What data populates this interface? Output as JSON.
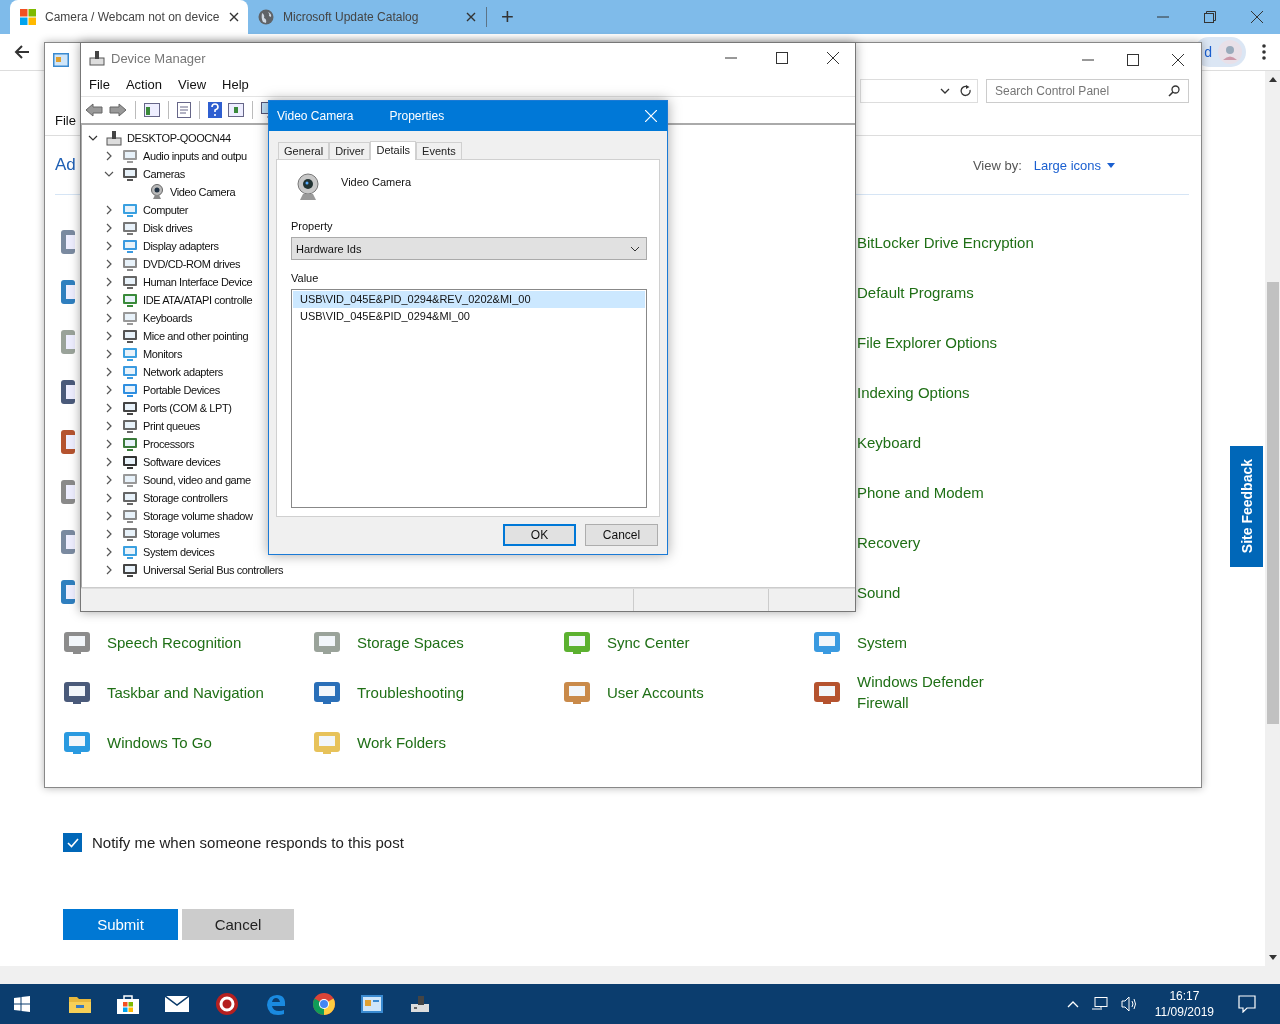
{
  "browser": {
    "tabs": [
      {
        "title": "Camera / Webcam not on device",
        "selected": true
      },
      {
        "title": "Microsoft Update Catalog",
        "selected": false
      }
    ],
    "new_tab": "+",
    "extension_label": "d"
  },
  "control_panel": {
    "menu_item": "File",
    "heading": "Ad",
    "search": {
      "placeholder": "Search Control Panel"
    },
    "view_by": {
      "label": "View by:",
      "value": "Large icons"
    },
    "items": [
      {
        "label": "BitLocker Drive Encryption"
      },
      {
        "label": "Default Programs"
      },
      {
        "label": "File Explorer Options"
      },
      {
        "label": "Indexing Options"
      },
      {
        "label": "Keyboard"
      },
      {
        "label": "Phone and Modem"
      },
      {
        "label": "Recovery"
      },
      {
        "label": "Sound"
      },
      {
        "label": "Speech Recognition"
      },
      {
        "label": "Storage Spaces"
      },
      {
        "label": "Sync Center"
      },
      {
        "label": "System"
      },
      {
        "label": "Taskbar and Navigation"
      },
      {
        "label": "Troubleshooting"
      },
      {
        "label": "User Accounts"
      },
      {
        "label": "Windows Defender Firewall"
      },
      {
        "label": "Windows To Go"
      },
      {
        "label": "Work Folders"
      }
    ]
  },
  "device_manager": {
    "title": "Device Manager",
    "menu": [
      "File",
      "Action",
      "View",
      "Help"
    ],
    "tree": {
      "label": "DESKTOP-QOOCN44",
      "expanded": true,
      "children": [
        {
          "label": "Audio inputs and outpu",
          "expanded": false
        },
        {
          "label": "Cameras",
          "expanded": true,
          "children": [
            {
              "label": "Video Camera"
            }
          ]
        },
        {
          "label": "Computer",
          "expanded": false
        },
        {
          "label": "Disk drives",
          "expanded": false
        },
        {
          "label": "Display adapters",
          "expanded": false
        },
        {
          "label": "DVD/CD-ROM drives",
          "expanded": false
        },
        {
          "label": "Human Interface Device",
          "expanded": false
        },
        {
          "label": "IDE ATA/ATAPI controlle",
          "expanded": false
        },
        {
          "label": "Keyboards",
          "expanded": false
        },
        {
          "label": "Mice and other pointing",
          "expanded": false
        },
        {
          "label": "Monitors",
          "expanded": false
        },
        {
          "label": "Network adapters",
          "expanded": false
        },
        {
          "label": "Portable Devices",
          "expanded": false
        },
        {
          "label": "Ports (COM & LPT)",
          "expanded": false
        },
        {
          "label": "Print queues",
          "expanded": false
        },
        {
          "label": "Processors",
          "expanded": false
        },
        {
          "label": "Software devices",
          "expanded": false
        },
        {
          "label": "Sound, video and game",
          "expanded": false
        },
        {
          "label": "Storage controllers",
          "expanded": false
        },
        {
          "label": "Storage volume shadow",
          "expanded": false
        },
        {
          "label": "Storage volumes",
          "expanded": false
        },
        {
          "label": "System devices",
          "expanded": false
        },
        {
          "label": "Universal Serial Bus controllers",
          "expanded": false
        }
      ]
    }
  },
  "properties_dialog": {
    "title": [
      "Video Camera",
      "Properties"
    ],
    "tabs": [
      {
        "label": "General",
        "selected": false
      },
      {
        "label": "Driver",
        "selected": false
      },
      {
        "label": "Details",
        "selected": true
      },
      {
        "label": "Events",
        "selected": false
      }
    ],
    "device_name": "Video Camera",
    "property_label": "Property",
    "property_value": "Hardware Ids",
    "value_label": "Value",
    "values": [
      {
        "text": "USB\\VID_045E&PID_0294&REV_0202&MI_00",
        "selected": true
      },
      {
        "text": "USB\\VID_045E&PID_0294&MI_00",
        "selected": false
      }
    ],
    "buttons": [
      {
        "label": "OK",
        "default": true
      },
      {
        "label": "Cancel",
        "default": false
      }
    ]
  },
  "site_feedback": "Site Feedback",
  "form": {
    "notify": {
      "label": "Notify me when someone responds to this post",
      "checked": true
    },
    "buttons": [
      {
        "label": "Submit",
        "kind": "primary"
      },
      {
        "label": "Cancel",
        "kind": "secondary"
      }
    ]
  },
  "taskbar": {
    "time": "16:17",
    "date": "11/09/2019"
  }
}
